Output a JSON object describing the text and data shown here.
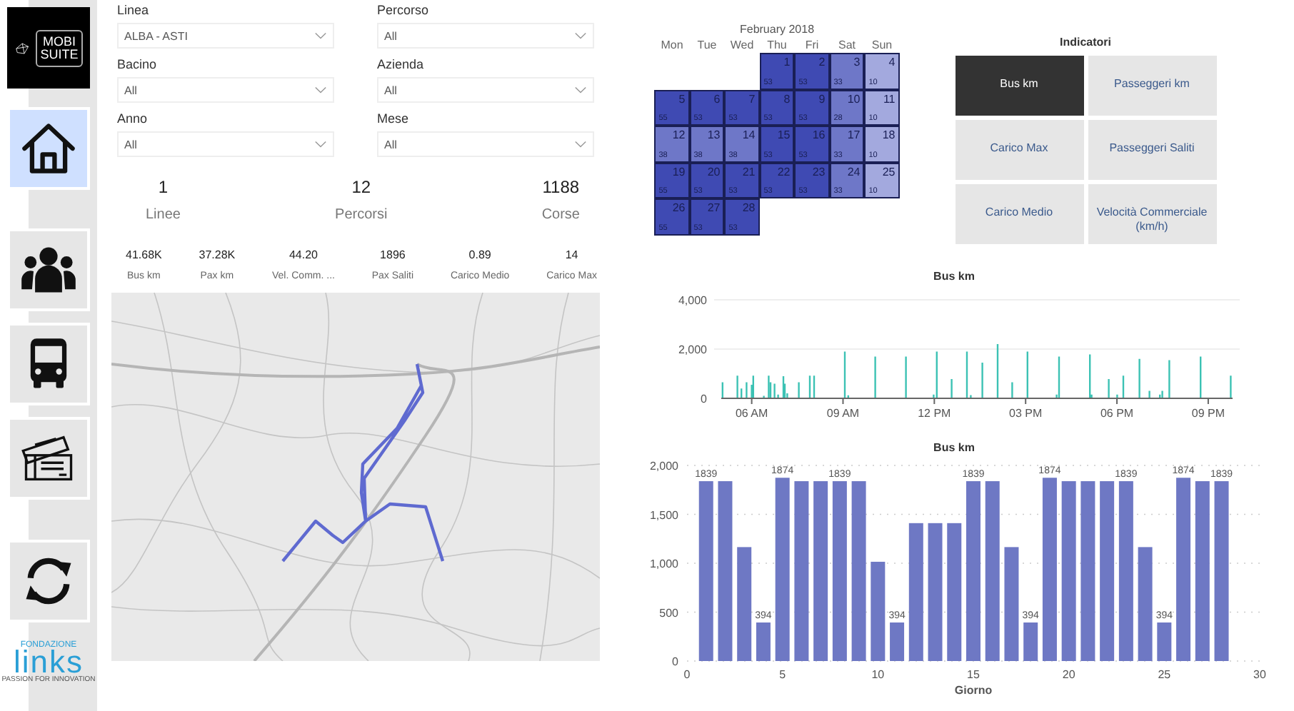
{
  "nav": {
    "logo": {
      "lines": [
        "MOBI",
        "SUITE"
      ]
    },
    "items": [
      {
        "kind": "home",
        "selected": true
      },
      {
        "kind": "people",
        "selected": false
      },
      {
        "kind": "bus",
        "selected": false
      },
      {
        "kind": "tickets",
        "selected": false
      },
      {
        "kind": "refresh",
        "selected": false
      }
    ],
    "footer_logo": {
      "top": "FONDAZIONE",
      "brand": "links",
      "tagline": "PASSION FOR INNOVATION"
    }
  },
  "filters": [
    {
      "label": "Linea",
      "value": "ALBA - ASTI"
    },
    {
      "label": "Percorso",
      "value": "All"
    },
    {
      "label": "Bacino",
      "value": "All"
    },
    {
      "label": "Azienda",
      "value": "All"
    },
    {
      "label": "Anno",
      "value": "All"
    },
    {
      "label": "Mese",
      "value": "All"
    }
  ],
  "kpis": [
    {
      "value": "1",
      "label": "Linee"
    },
    {
      "value": "12",
      "label": "Percorsi"
    },
    {
      "value": "1188",
      "label": "Corse"
    }
  ],
  "metrics": [
    {
      "value": "41.68K",
      "label": "Bus km"
    },
    {
      "value": "37.28K",
      "label": "Pax km"
    },
    {
      "value": "44.20",
      "label": "Vel. Comm. ..."
    },
    {
      "value": "1896",
      "label": "Pax Saliti"
    },
    {
      "value": "0.89",
      "label": "Carico Medio"
    },
    {
      "value": "14",
      "label": "Carico Max"
    }
  ],
  "calendar": {
    "title": "February 2018",
    "weekdays": [
      "Mon",
      "Tue",
      "Wed",
      "Thu",
      "Fri",
      "Sat",
      "Sun"
    ],
    "weeks": [
      {
        "days": [
          {
            "kind": "empty"
          },
          {
            "kind": "empty"
          },
          {
            "kind": "empty"
          },
          {
            "kind": "day",
            "day": "1",
            "count": "53",
            "color": "#3f4ab3"
          },
          {
            "day": "2",
            "count": "53",
            "color": "#3f4ab3"
          },
          {
            "day": "3",
            "count": "33",
            "color": "#6e77c8"
          },
          {
            "day": "4",
            "count": "10",
            "color": "#a3a9de"
          }
        ]
      },
      {
        "days": [
          {
            "day": "5",
            "count": "55",
            "color": "#3f4ab3"
          },
          {
            "day": "6",
            "count": "53",
            "color": "#3f4ab3"
          },
          {
            "day": "7",
            "count": "53",
            "color": "#3f4ab3"
          },
          {
            "day": "8",
            "count": "53",
            "color": "#3f4ab3"
          },
          {
            "day": "9",
            "count": "53",
            "color": "#3f4ab3"
          },
          {
            "day": "10",
            "count": "28",
            "color": "#6e77c8"
          },
          {
            "day": "11",
            "count": "10",
            "color": "#a3a9de"
          }
        ]
      },
      {
        "days": [
          {
            "day": "12",
            "count": "38",
            "color": "#6e77c8"
          },
          {
            "day": "13",
            "count": "38",
            "color": "#6e77c8"
          },
          {
            "day": "14",
            "count": "38",
            "color": "#6e77c8"
          },
          {
            "day": "15",
            "count": "53",
            "color": "#3f4ab3"
          },
          {
            "day": "16",
            "count": "53",
            "color": "#3f4ab3"
          },
          {
            "day": "17",
            "count": "33",
            "color": "#6e77c8"
          },
          {
            "day": "18",
            "count": "10",
            "color": "#a3a9de"
          }
        ]
      },
      {
        "days": [
          {
            "day": "19",
            "count": "55",
            "color": "#3f4ab3"
          },
          {
            "day": "20",
            "count": "53",
            "color": "#3f4ab3"
          },
          {
            "day": "21",
            "count": "53",
            "color": "#3f4ab3"
          },
          {
            "day": "22",
            "count": "53",
            "color": "#3f4ab3"
          },
          {
            "day": "23",
            "count": "53",
            "color": "#3f4ab3"
          },
          {
            "day": "24",
            "count": "33",
            "color": "#6e77c8"
          },
          {
            "day": "25",
            "count": "10",
            "color": "#a3a9de"
          }
        ]
      },
      {
        "days": [
          {
            "day": "26",
            "count": "55",
            "color": "#3f4ab3"
          },
          {
            "day": "27",
            "count": "53",
            "color": "#3f4ab3"
          },
          {
            "day": "28",
            "count": "53",
            "color": "#3f4ab3"
          }
        ]
      }
    ]
  },
  "indicators": {
    "title": "Indicatori",
    "buttons": [
      {
        "label": "Bus km",
        "selected": true
      },
      {
        "label": "Passeggeri km",
        "selected": false
      },
      {
        "label": "Carico Max",
        "selected": false
      },
      {
        "label": "Passeggeri Saliti",
        "selected": false
      },
      {
        "label": "Carico Medio",
        "selected": false
      },
      {
        "label": "Velocità Commerciale (km/h)",
        "selected": false
      }
    ]
  },
  "time_chart": {
    "title": "Bus km",
    "y_labels": [
      "4,000",
      "2,000",
      "0"
    ],
    "x_labels": [
      "06 AM",
      "09 AM",
      "12 PM",
      "03 PM",
      "06 PM",
      "09 PM"
    ]
  },
  "day_chart": {
    "chart_data": {
      "type": "bar",
      "title": "Bus km",
      "xlabel": "Giorno",
      "x": [
        1,
        2,
        3,
        4,
        5,
        6,
        7,
        8,
        9,
        10,
        11,
        12,
        13,
        14,
        15,
        16,
        17,
        18,
        19,
        20,
        21,
        22,
        23,
        24,
        25,
        26,
        27,
        28
      ],
      "series": [
        {
          "color": "#6e78c4",
          "values": [
            1839,
            1839,
            1165,
            394,
            1874,
            1839,
            1839,
            1839,
            1839,
            1015,
            394,
            1410,
            1410,
            1410,
            1839,
            1839,
            1165,
            394,
            1874,
            1839,
            1839,
            1839,
            1839,
            1165,
            394,
            1874,
            1839,
            1839
          ]
        }
      ],
      "value_labels": [
        "1839",
        null,
        null,
        "394",
        "1874",
        null,
        null,
        "1839",
        null,
        null,
        "394",
        null,
        null,
        null,
        "1839",
        null,
        null,
        "394",
        "1874",
        null,
        null,
        null,
        "1839",
        null,
        "394",
        "1874",
        null,
        "1839"
      ],
      "xlim": [
        0,
        30
      ],
      "ylim": [
        0,
        2000
      ],
      "grid": true,
      "xticks": [
        0,
        5,
        10,
        15,
        20,
        25,
        30
      ],
      "yticks": [
        {
          "value": 0,
          "label": "0"
        },
        {
          "value": 500,
          "label": "500"
        },
        {
          "value": 1000,
          "label": "1,000"
        },
        {
          "value": 1500,
          "label": "1,500"
        },
        {
          "value": 2000,
          "label": "2,000"
        }
      ]
    }
  }
}
